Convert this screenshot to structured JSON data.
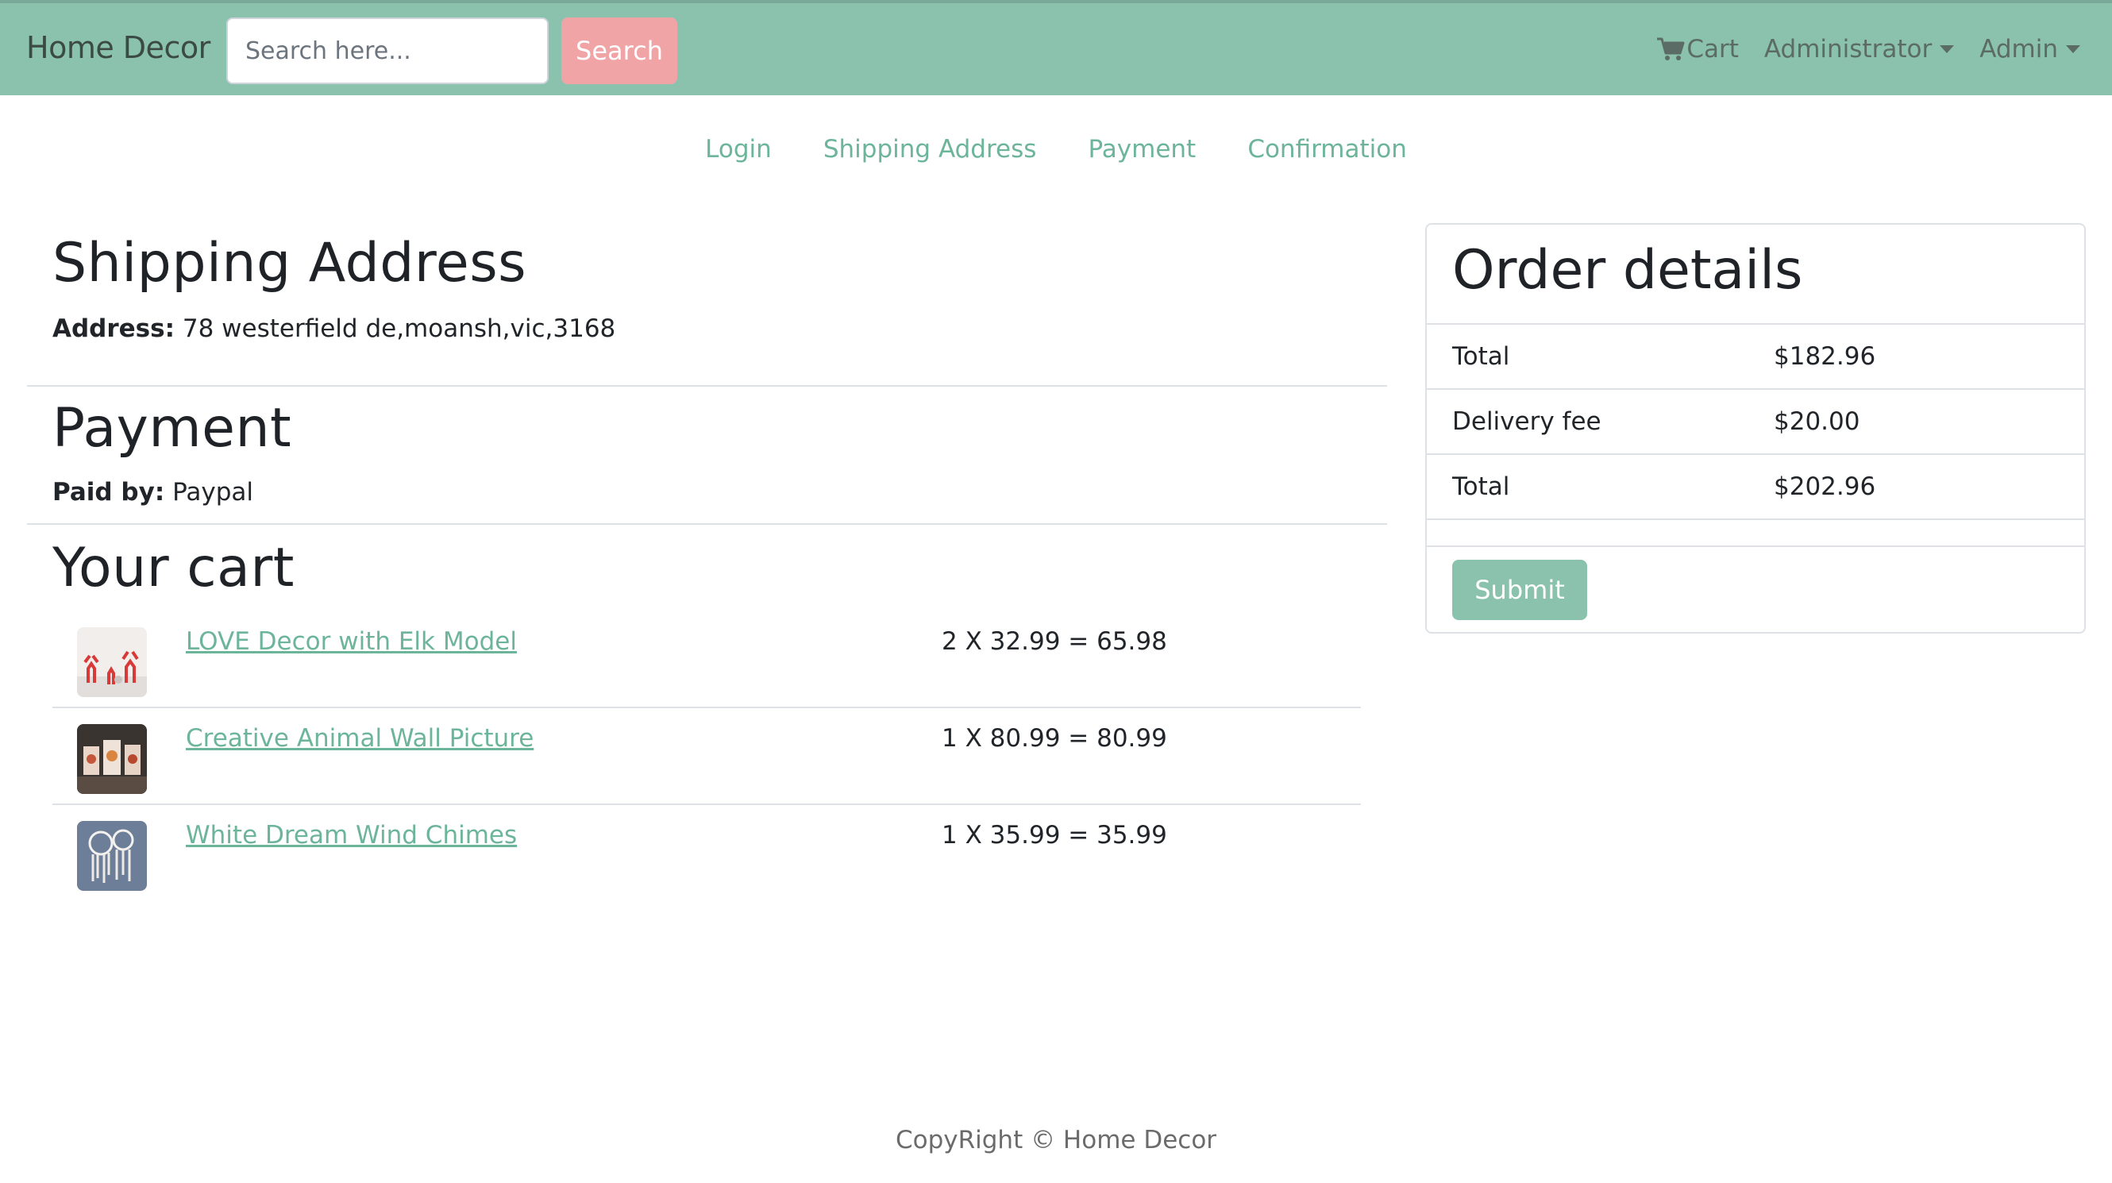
{
  "navbar": {
    "brand": "Home Decor",
    "search_placeholder": "Search here...",
    "search_label": "Search",
    "cart_label": "Cart",
    "admin_menu_label": "Administrator",
    "user_menu_label": "Admin"
  },
  "steps": [
    "Login",
    "Shipping Address",
    "Payment",
    "Confirmation"
  ],
  "shipping": {
    "title": "Shipping Address",
    "address_label": "Address:",
    "address_value": "78 westerfield de,moansh,vic,3168"
  },
  "payment": {
    "title": "Payment",
    "paid_label": "Paid by:",
    "paid_value": "Paypal"
  },
  "cart": {
    "title": "Your cart",
    "items": [
      {
        "name": "LOVE Decor with Elk Model",
        "calc": "2 X 32.99 = 65.98"
      },
      {
        "name": "Creative Animal Wall Picture",
        "calc": "1 X 80.99 = 80.99"
      },
      {
        "name": "White Dream Wind Chimes",
        "calc": "1 X 35.99 = 35.99"
      }
    ]
  },
  "order": {
    "title": "Order details",
    "rows": [
      {
        "label": "Total",
        "value": "$182.96"
      },
      {
        "label": "Delivery fee",
        "value": "$20.00"
      },
      {
        "label": "Total",
        "value": "$202.96"
      }
    ],
    "submit_label": "Submit"
  },
  "footer": "CopyRight © Home Decor",
  "colors": {
    "navbar_bg": "#8bc2ad",
    "search_button": "#f0a4a6",
    "link": "#6cb49a",
    "submit_button": "#8bc2ad"
  },
  "icons": [
    "cart-icon",
    "caret-down-icon"
  ]
}
